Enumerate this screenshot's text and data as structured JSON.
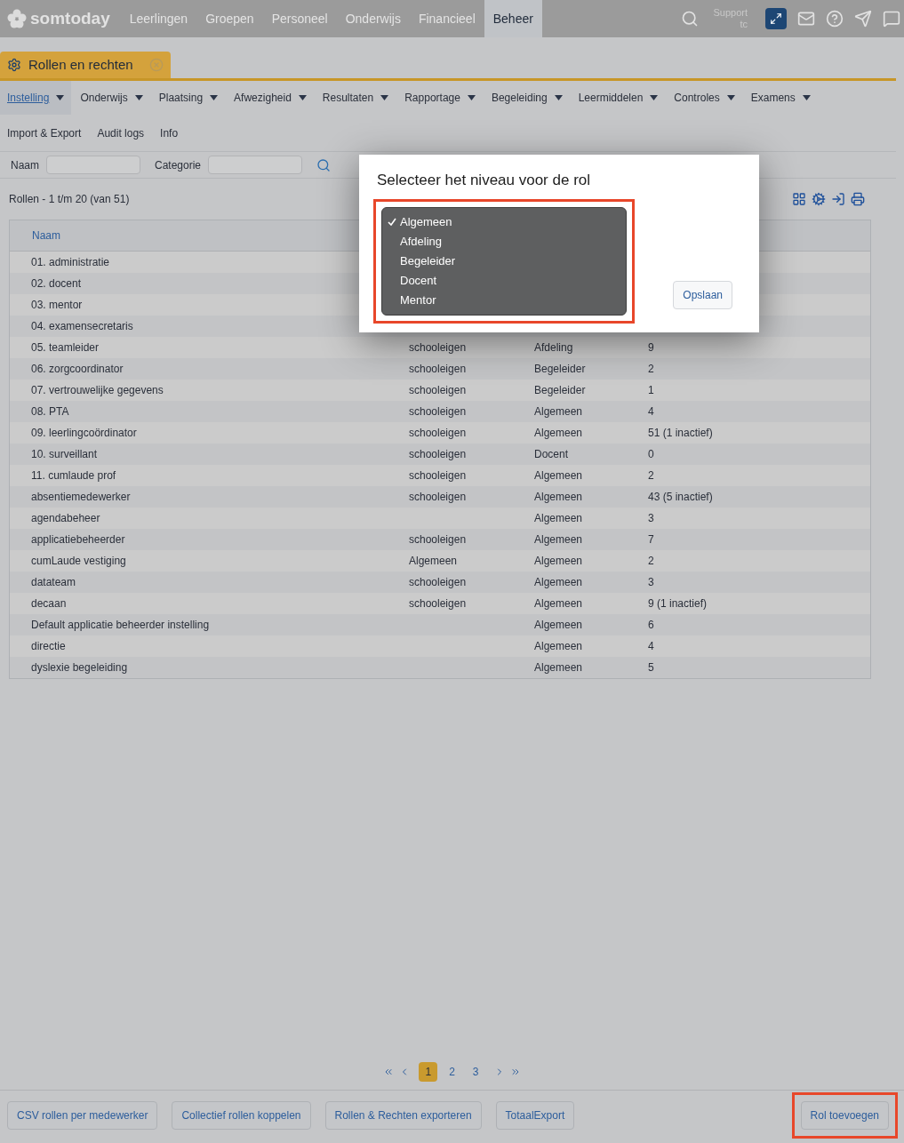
{
  "topbar": {
    "brand": "somtoday",
    "nav": [
      {
        "label": "Leerlingen",
        "selected": false
      },
      {
        "label": "Groepen",
        "selected": false
      },
      {
        "label": "Personeel",
        "selected": false
      },
      {
        "label": "Onderwijs",
        "selected": false
      },
      {
        "label": "Financieel",
        "selected": false
      },
      {
        "label": "Beheer",
        "selected": true
      }
    ],
    "user": [
      "Support",
      "tc"
    ]
  },
  "page_tab": {
    "label": "Rollen en rechten"
  },
  "menu": [
    {
      "label": "Instelling",
      "selected": true,
      "dropdown": true
    },
    {
      "label": "Onderwijs",
      "selected": false,
      "dropdown": true
    },
    {
      "label": "Plaatsing",
      "selected": false,
      "dropdown": true
    },
    {
      "label": "Afwezigheid",
      "selected": false,
      "dropdown": true
    },
    {
      "label": "Resultaten",
      "selected": false,
      "dropdown": true
    },
    {
      "label": "Rapportage",
      "selected": false,
      "dropdown": true
    },
    {
      "label": "Begeleiding",
      "selected": false,
      "dropdown": true
    },
    {
      "label": "Leermiddelen",
      "selected": false,
      "dropdown": true
    },
    {
      "label": "Controles",
      "selected": false,
      "dropdown": true
    },
    {
      "label": "Examens",
      "selected": false,
      "dropdown": true
    }
  ],
  "submenu": [
    "Import & Export",
    "Audit logs",
    "Info"
  ],
  "filters": [
    {
      "label": "Naam"
    },
    {
      "label": "Categorie"
    }
  ],
  "count": "Rollen - 1 t/m 20 (van 51)",
  "table": {
    "columns": [
      "Naam"
    ],
    "rows": [
      {
        "naam": "01. administratie"
      },
      {
        "naam": "02. docent"
      },
      {
        "naam": "03. mentor"
      },
      {
        "naam": "04. examensecretaris"
      },
      {
        "naam": "05. teamleider",
        "categorie": "schooleigen",
        "niveau": "Afdeling",
        "aantal": "9"
      },
      {
        "naam": "06. zorgcoordinator",
        "categorie": "schooleigen",
        "niveau": "Begeleider",
        "aantal": "2"
      },
      {
        "naam": "07. vertrouwelijke gegevens",
        "categorie": "schooleigen",
        "niveau": "Begeleider",
        "aantal": "1"
      },
      {
        "naam": "08. PTA",
        "categorie": "schooleigen",
        "niveau": "Algemeen",
        "aantal": "4"
      },
      {
        "naam": "09. leerlingcoördinator",
        "categorie": "schooleigen",
        "niveau": "Algemeen",
        "aantal": "51 (1 inactief)"
      },
      {
        "naam": "10. surveillant",
        "categorie": "schooleigen",
        "niveau": "Docent",
        "aantal": "0"
      },
      {
        "naam": "11. cumlaude prof",
        "categorie": "schooleigen",
        "niveau": "Algemeen",
        "aantal": "2"
      },
      {
        "naam": "absentiemedewerker",
        "categorie": "schooleigen",
        "niveau": "Algemeen",
        "aantal": "43 (5 inactief)"
      },
      {
        "naam": "agendabeheer",
        "niveau": "Algemeen",
        "aantal": "3"
      },
      {
        "naam": "applicatiebeheerder",
        "categorie": "schooleigen",
        "niveau": "Algemeen",
        "aantal": "7"
      },
      {
        "naam": "cumLaude vestiging",
        "categorie": "Algemeen",
        "niveau": "Algemeen",
        "aantal": "2"
      },
      {
        "naam": "datateam",
        "categorie": "schooleigen",
        "niveau": "Algemeen",
        "aantal": "3"
      },
      {
        "naam": "decaan",
        "categorie": "schooleigen",
        "niveau": "Algemeen",
        "aantal": "9 (1 inactief)"
      },
      {
        "naam": "Default applicatie beheerder instelling",
        "niveau": "Algemeen",
        "aantal": "6"
      },
      {
        "naam": "directie",
        "niveau": "Algemeen",
        "aantal": "4"
      },
      {
        "naam": "dyslexie begeleiding",
        "niveau": "Algemeen",
        "aantal": "5"
      }
    ]
  },
  "pagination": [
    {
      "label": "1",
      "selected": true
    },
    {
      "label": "2",
      "selected": false
    },
    {
      "label": "3",
      "selected": false
    }
  ],
  "footer_buttons": [
    {
      "label": "CSV rollen per medewerker",
      "highlighted": false
    },
    {
      "label": "Collectief rollen koppelen",
      "highlighted": false
    },
    {
      "label": "Rollen & Rechten exporteren",
      "highlighted": false
    },
    {
      "label": "TotaalExport",
      "highlighted": false
    },
    {
      "label": "Rol toevoegen",
      "highlighted": true
    }
  ],
  "dialog": {
    "title": "Selecteer het niveau voor de rol",
    "highlighted": true,
    "options": [
      {
        "label": "Algemeen",
        "selected": true
      },
      {
        "label": "Afdeling",
        "selected": false
      },
      {
        "label": "Begeleider",
        "selected": false
      },
      {
        "label": "Docent",
        "selected": false
      },
      {
        "label": "Mentor",
        "selected": false
      }
    ],
    "button": "Opslaan"
  }
}
